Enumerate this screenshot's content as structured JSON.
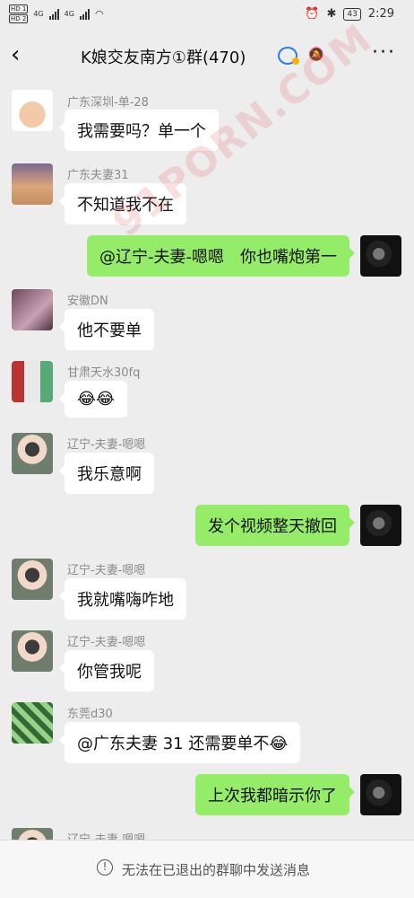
{
  "status_bar": {
    "time": "2:29",
    "battery": "43",
    "sim1": "HD 1",
    "sim2": "HD 2",
    "net1": "4G",
    "net2": "4G"
  },
  "header": {
    "title": "K娘交友南方①群(470)"
  },
  "messages": [
    {
      "dir": "in",
      "sender": "广东深圳-单-28",
      "text": "我需要吗？单一个",
      "avatar": "kid-avatar"
    },
    {
      "dir": "in",
      "sender": "广东夫妻31",
      "text": "不知道我不在",
      "avatar": "desert-avatar"
    },
    {
      "dir": "out",
      "text": "@辽宁-夫妻-嗯嗯　你也嘴炮第一",
      "avatar": "self-avatar"
    },
    {
      "dir": "in",
      "sender": "安徽DN",
      "text": "他不要单",
      "avatar": "anime-avatar"
    },
    {
      "dir": "in",
      "sender": "甘肃天水30fq",
      "text": "😂😂",
      "avatar": "bottle-avatar"
    },
    {
      "dir": "in",
      "sender": "辽宁-夫妻-嗯嗯",
      "text": "我乐意啊",
      "avatar": "doll-avatar"
    },
    {
      "dir": "out",
      "text": "发个视频整天撤回",
      "avatar": "self-avatar"
    },
    {
      "dir": "in",
      "sender": "辽宁-夫妻-嗯嗯",
      "text": "我就嘴嗨咋地",
      "avatar": "doll-avatar"
    },
    {
      "dir": "in",
      "sender": "辽宁-夫妻-嗯嗯",
      "text": "你管我呢",
      "avatar": "doll-avatar"
    },
    {
      "dir": "in",
      "sender": "东莞d30",
      "text": "@广东夫妻 31  还需要单不😂",
      "avatar": "green-avatar"
    },
    {
      "dir": "out",
      "text": "上次我都暗示你了",
      "avatar": "self-avatar"
    },
    {
      "dir": "in",
      "sender": "辽宁-夫妻-嗯嗯",
      "text": "",
      "avatar": "doll-avatar"
    }
  ],
  "footer": {
    "notice": "无法在已退出的群聊中发送消息"
  }
}
